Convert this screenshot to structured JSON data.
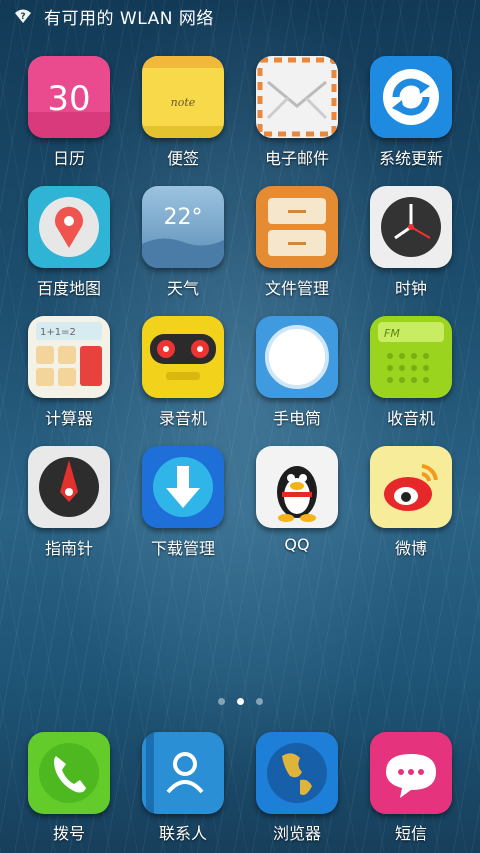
{
  "status_bar": {
    "wifi_icon": "wifi-question-icon",
    "notice": "有可用的 WLAN 网络"
  },
  "apps": [
    {
      "label": "日历",
      "icon": "calendar-icon",
      "badge_text": "30",
      "color": "#e94b8e"
    },
    {
      "label": "便签",
      "icon": "note-icon",
      "badge_text": "note",
      "color": "#f7d94a"
    },
    {
      "label": "电子邮件",
      "icon": "mail-icon",
      "color": "#f2f2f2"
    },
    {
      "label": "系统更新",
      "icon": "refresh-icon",
      "color": "#1e8ae0"
    },
    {
      "label": "百度地图",
      "icon": "map-pin-icon",
      "color": "#2fb4d6"
    },
    {
      "label": "天气",
      "icon": "weather-icon",
      "badge_text": "22°",
      "color": "#6e9fc5"
    },
    {
      "label": "文件管理",
      "icon": "folder-drawer-icon",
      "color": "#e58b32"
    },
    {
      "label": "时钟",
      "icon": "clock-icon",
      "color": "#eeeeee"
    },
    {
      "label": "计算器",
      "icon": "calculator-icon",
      "badge_text": "1+1=2",
      "color": "#f4f1e6"
    },
    {
      "label": "录音机",
      "icon": "cassette-icon",
      "color": "#f2d21a"
    },
    {
      "label": "手电筒",
      "icon": "flashlight-icon",
      "color": "#3f9ae0"
    },
    {
      "label": "收音机",
      "icon": "radio-icon",
      "badge_text": "FM",
      "color": "#9bd41f"
    },
    {
      "label": "指南针",
      "icon": "compass-icon",
      "color": "#e9e9e9"
    },
    {
      "label": "下载管理",
      "icon": "download-icon",
      "color": "#1f6fd9"
    },
    {
      "label": "QQ",
      "icon": "qq-penguin-icon",
      "color": "#f3f3f3"
    },
    {
      "label": "微博",
      "icon": "weibo-icon",
      "color": "#f7ec9a"
    }
  ],
  "page_indicator": {
    "count": 3,
    "active": 2
  },
  "dock": [
    {
      "label": "拨号",
      "icon": "phone-icon",
      "color": "#63cc2b"
    },
    {
      "label": "联系人",
      "icon": "contacts-icon",
      "color": "#2b8fd6"
    },
    {
      "label": "浏览器",
      "icon": "globe-icon",
      "color": "#1d7fd8"
    },
    {
      "label": "短信",
      "icon": "message-icon",
      "color": "#e5337e"
    }
  ]
}
